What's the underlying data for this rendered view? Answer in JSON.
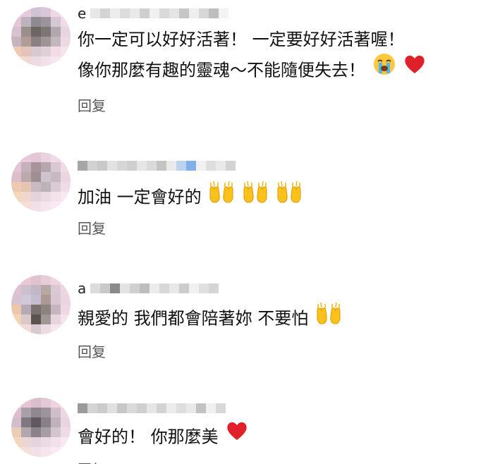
{
  "comments": [
    {
      "username_visible": "e",
      "lines": [
        "你一定可以好好活著！ 一定要好好活著喔！",
        "像你那麼有趣的靈魂～不能隨便失去！"
      ],
      "emojis": [
        "loudly-crying-face-emoji",
        "red-heart-emoji"
      ],
      "reply_label": "回复"
    },
    {
      "username_visible": "",
      "lines": [
        "加油 一定會好的"
      ],
      "emojis": [
        "raising-hands-emoji",
        "raising-hands-emoji",
        "raising-hands-emoji"
      ],
      "reply_label": "回复"
    },
    {
      "username_visible": "a",
      "lines": [
        "親愛的 我們都會陪著妳 不要怕"
      ],
      "emojis": [
        "raising-hands-emoji"
      ],
      "reply_label": "回复"
    },
    {
      "username_visible": "",
      "lines": [
        "會好的！ 你那麼美"
      ],
      "emojis": [
        "red-heart-emoji"
      ],
      "reply_label": "回复"
    }
  ],
  "colors": {
    "reply_text": "#555555",
    "heart": "#e0202a",
    "hands": "#f4b400"
  }
}
